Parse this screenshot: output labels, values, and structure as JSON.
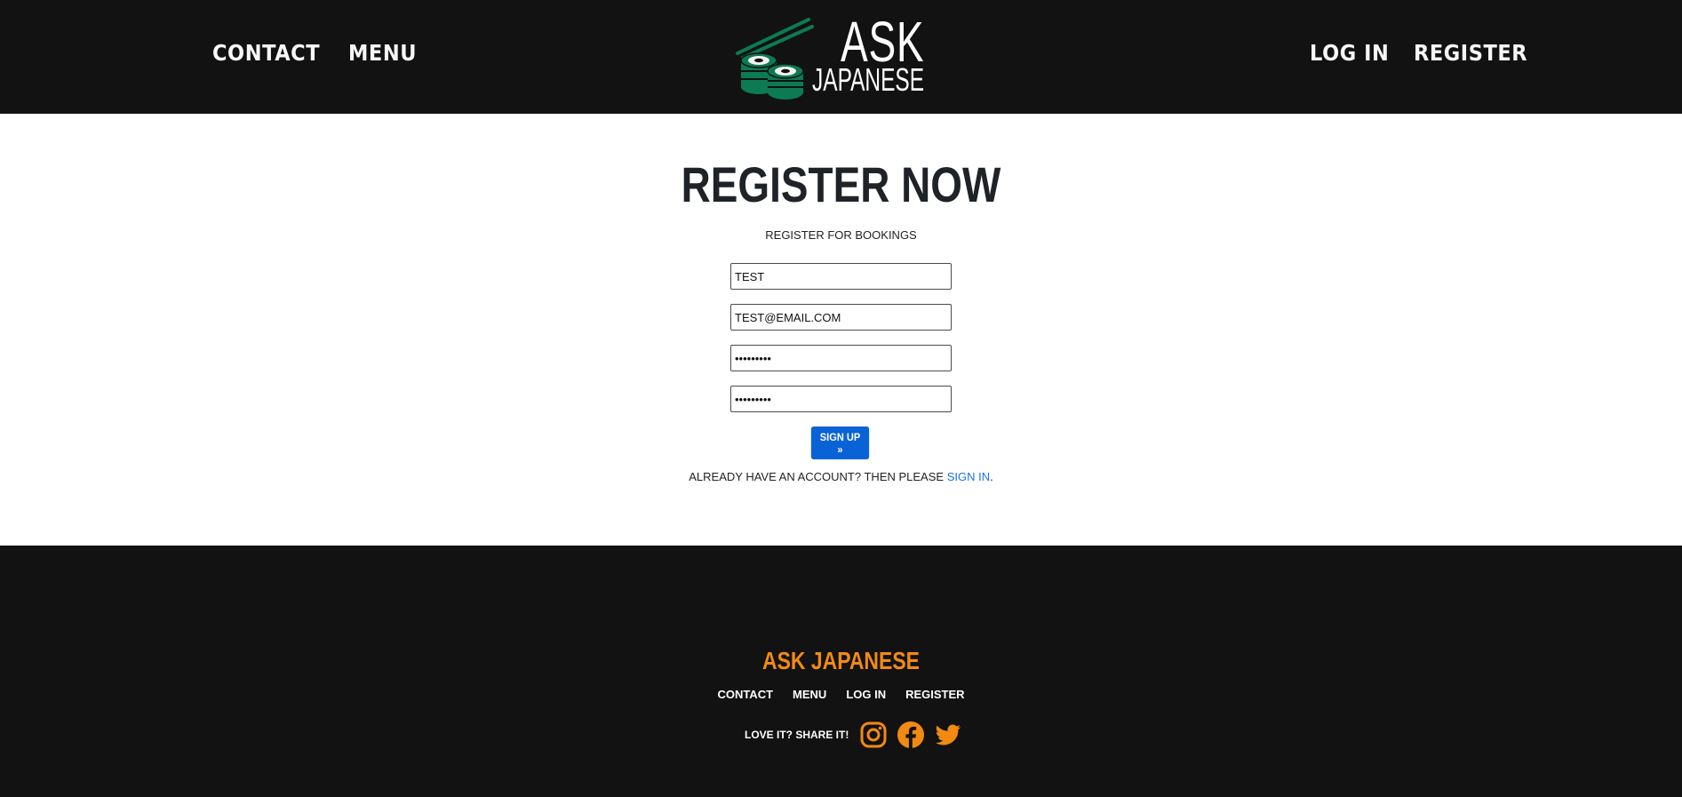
{
  "header": {
    "nav_left": {
      "contact": "CONTACT",
      "menu": "MENU"
    },
    "nav_right": {
      "login": "LOG IN",
      "register": "REGISTER"
    },
    "logo": {
      "line1": "ASK",
      "line2": "JAPANESE"
    }
  },
  "form": {
    "title": "REGISTER NOW",
    "subtitle": "REGISTER FOR BOOKINGS",
    "fields": {
      "name": {
        "value": "TEST"
      },
      "email": {
        "value": "TEST@EMAIL.COM"
      },
      "password": {
        "value": "123456789"
      },
      "password_confirm": {
        "value": "123456789"
      }
    },
    "submit_label": "SIGN UP »",
    "already_text": "ALREADY HAVE AN ACCOUNT? THEN PLEASE",
    "signin_link": "SIGN IN",
    "already_end": "."
  },
  "footer": {
    "brand": "ASK JAPANESE",
    "links": {
      "contact": "CONTACT",
      "menu": "MENU",
      "login": "LOG IN",
      "register": "REGISTER"
    },
    "share_text": "LOVE IT? SHARE IT!",
    "social": [
      "instagram-icon",
      "facebook-icon",
      "twitter-icon"
    ]
  },
  "colors": {
    "header_bg": "#121212",
    "accent_orange": "#f28a12",
    "button_blue": "#0a63d6",
    "link_blue": "#1a73e8",
    "logo_green": "#0c7a52"
  }
}
